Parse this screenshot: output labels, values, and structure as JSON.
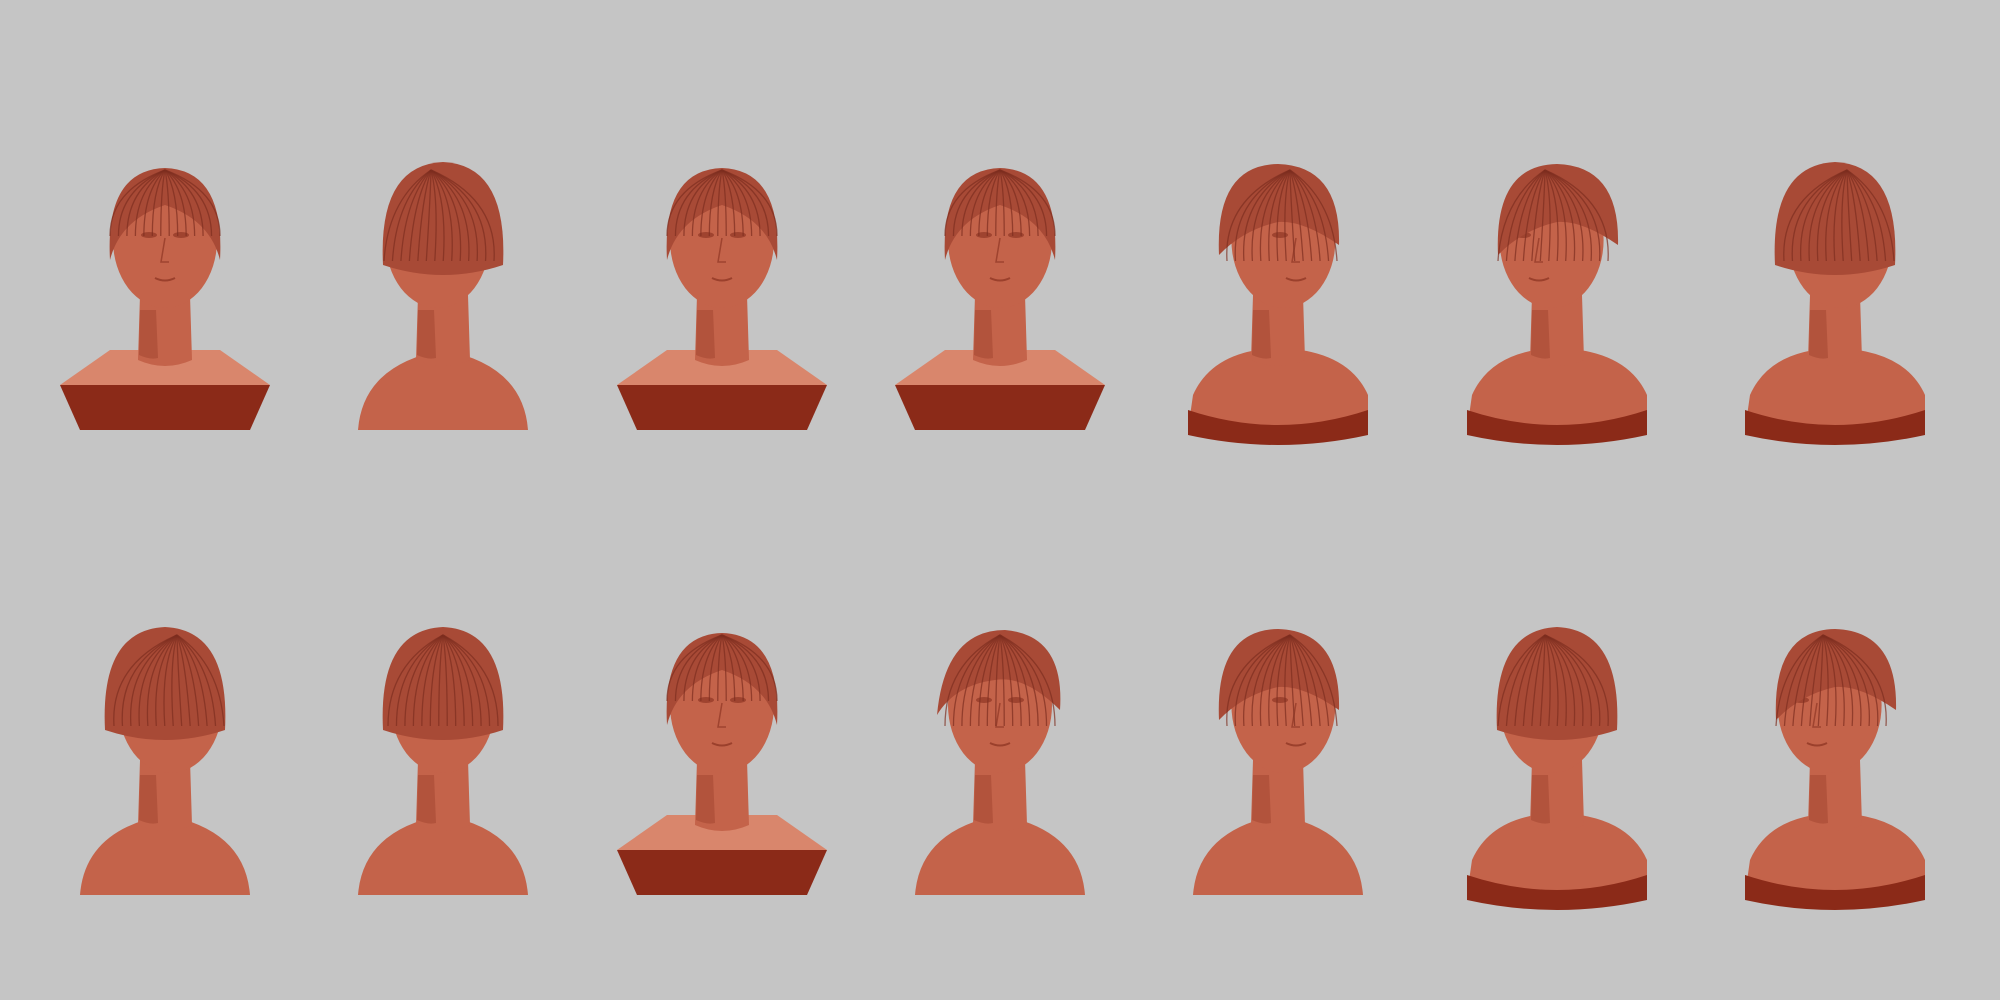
{
  "scene": {
    "background_color": "#c5c5c5",
    "material_colors": {
      "skin": "#c4634a",
      "skin_light": "#d9866c",
      "shadow": "#7a2414",
      "base_side": "#8b2a18",
      "hair": "#a84a36",
      "hair_line": "#7d2e1f"
    },
    "rows": [
      {
        "row_name": "top-row",
        "busts": [
          {
            "view": "front",
            "base": "faceted"
          },
          {
            "view": "left-back",
            "base": "none"
          },
          {
            "view": "front",
            "base": "faceted"
          },
          {
            "view": "front",
            "base": "faceted"
          },
          {
            "view": "right",
            "base": "rounded"
          },
          {
            "view": "left",
            "base": "rounded"
          },
          {
            "view": "back-right",
            "base": "rounded"
          }
        ]
      },
      {
        "row_name": "bottom-row",
        "busts": [
          {
            "view": "back-right",
            "base": "none"
          },
          {
            "view": "back",
            "base": "none"
          },
          {
            "view": "front",
            "base": "faceted"
          },
          {
            "view": "top-down",
            "base": "none"
          },
          {
            "view": "right",
            "base": "none"
          },
          {
            "view": "back-left",
            "base": "rounded"
          },
          {
            "view": "left",
            "base": "rounded"
          }
        ]
      }
    ]
  }
}
